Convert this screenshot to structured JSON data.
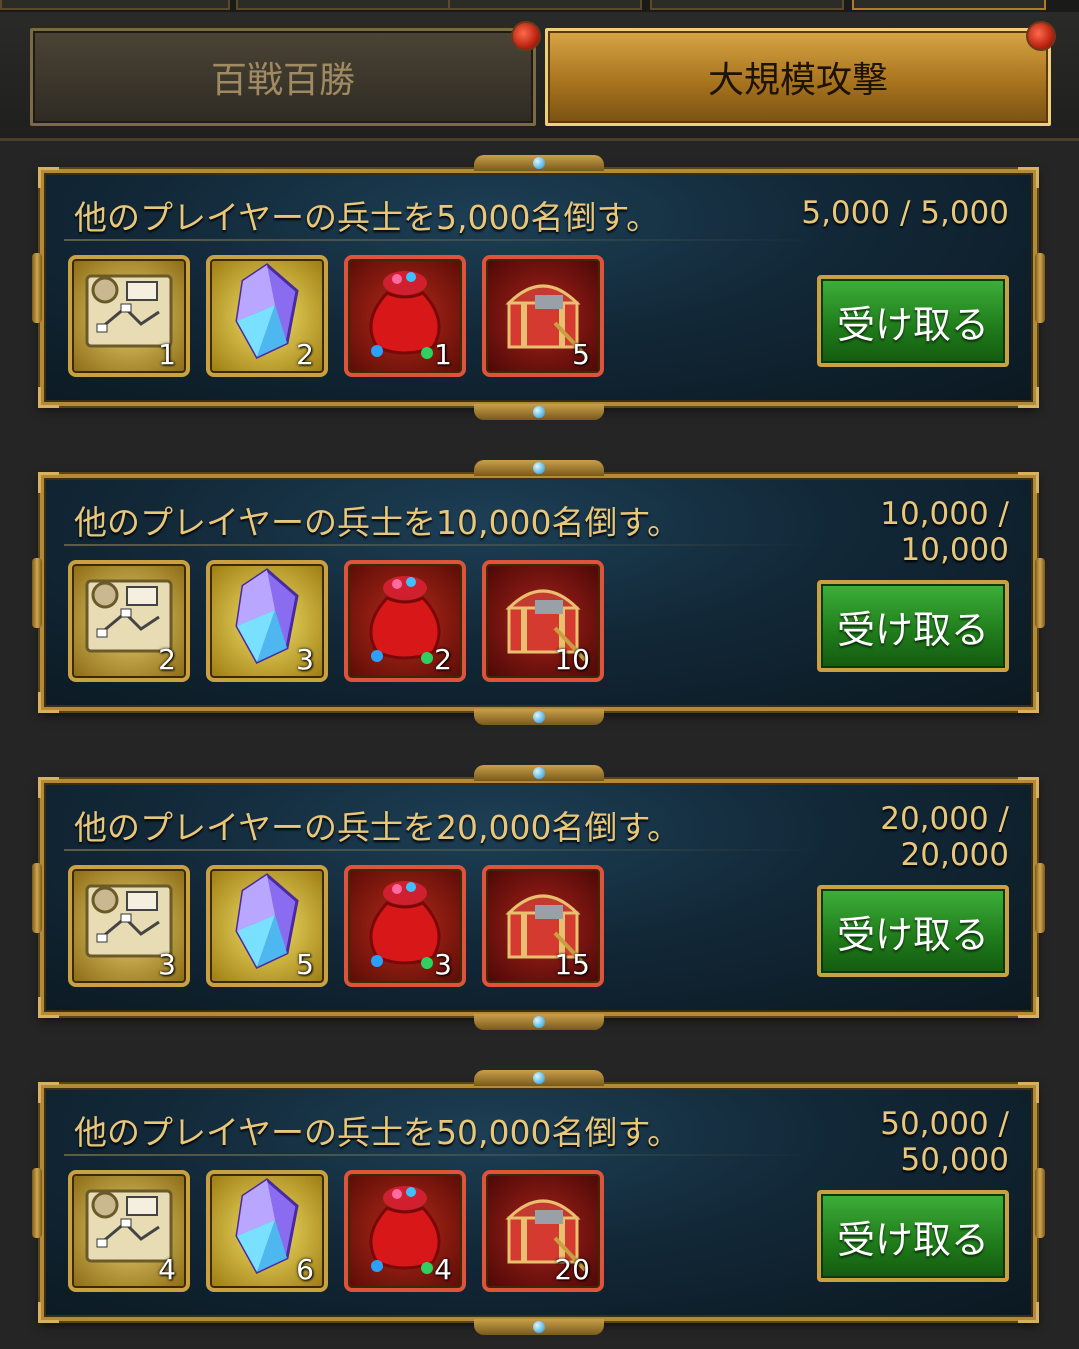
{
  "tabs": [
    {
      "label": "百戦百勝",
      "active": false,
      "has_badge": true
    },
    {
      "label": "大規模攻撃",
      "active": true,
      "has_badge": true
    }
  ],
  "accent_colors": {
    "gold": "#e9c77a",
    "claim_green": "#2a9a25",
    "badge_red": "#d0301a"
  },
  "quests": [
    {
      "title": "他のプレイヤーの兵士を5,000名倒す。",
      "progress_line1": "5,000 / 5,000",
      "progress_line2": "",
      "rewards": [
        {
          "icon": "map-icon",
          "count": "1"
        },
        {
          "icon": "crystal-icon",
          "count": "2"
        },
        {
          "icon": "gift-bag-icon",
          "count": "1"
        },
        {
          "icon": "treasure-chest-icon",
          "count": "5"
        }
      ],
      "claim_label": "受け取る"
    },
    {
      "title": "他のプレイヤーの兵士を10,000名倒す。",
      "progress_line1": "10,000 /",
      "progress_line2": "10,000",
      "rewards": [
        {
          "icon": "map-icon",
          "count": "2"
        },
        {
          "icon": "crystal-icon",
          "count": "3"
        },
        {
          "icon": "gift-bag-icon",
          "count": "2"
        },
        {
          "icon": "treasure-chest-icon",
          "count": "10"
        }
      ],
      "claim_label": "受け取る"
    },
    {
      "title": "他のプレイヤーの兵士を20,000名倒す。",
      "progress_line1": "20,000 /",
      "progress_line2": "20,000",
      "rewards": [
        {
          "icon": "map-icon",
          "count": "3"
        },
        {
          "icon": "crystal-icon",
          "count": "5"
        },
        {
          "icon": "gift-bag-icon",
          "count": "3"
        },
        {
          "icon": "treasure-chest-icon",
          "count": "15"
        }
      ],
      "claim_label": "受け取る"
    },
    {
      "title": "他のプレイヤーの兵士を50,000名倒す。",
      "progress_line1": "50,000 /",
      "progress_line2": "50,000",
      "rewards": [
        {
          "icon": "map-icon",
          "count": "4"
        },
        {
          "icon": "crystal-icon",
          "count": "6"
        },
        {
          "icon": "gift-bag-icon",
          "count": "4"
        },
        {
          "icon": "treasure-chest-icon",
          "count": "20"
        }
      ],
      "claim_label": "受け取る"
    }
  ]
}
